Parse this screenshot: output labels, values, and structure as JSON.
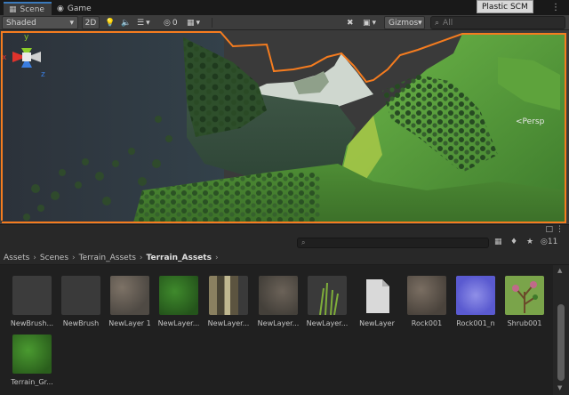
{
  "tabs": [
    {
      "label": "Scene",
      "icon": "grid-icon",
      "active": true
    },
    {
      "label": "Game",
      "icon": "gamepad-icon",
      "active": false
    }
  ],
  "plastic_label": "Plastic SCM",
  "toolbar": {
    "shading_mode": "Shaded",
    "mode_2d": "2D",
    "hidden_count": "0",
    "gizmos_label": "Gizmos",
    "search_placeholder": "All"
  },
  "viewport": {
    "projection_label": "Persp",
    "axes": {
      "x": "x",
      "y": "y",
      "z": "z"
    }
  },
  "project": {
    "visible_count": "11",
    "breadcrumb": [
      "Assets",
      "Scenes",
      "Terrain_Assets",
      "Terrain_Assets"
    ],
    "assets": [
      {
        "name": "NewBrush...",
        "thumb": "brush"
      },
      {
        "name": "NewBrush",
        "thumb": "plain"
      },
      {
        "name": "NewLayer 1",
        "thumb": "dirt"
      },
      {
        "name": "NewLayer...",
        "thumb": "grass"
      },
      {
        "name": "NewLayer...",
        "thumb": "bark"
      },
      {
        "name": "NewLayer...",
        "thumb": "dirt"
      },
      {
        "name": "NewLayer...",
        "thumb": "reeds"
      },
      {
        "name": "NewLayer",
        "thumb": "file"
      },
      {
        "name": "Rock001",
        "thumb": "rock"
      },
      {
        "name": "Rock001_n",
        "thumb": "normal"
      },
      {
        "name": "Shrub001",
        "thumb": "shrub"
      },
      {
        "name": "Terrain_Gr...",
        "thumb": "grass"
      }
    ]
  },
  "colors": {
    "selection_outline": "#f57c1f",
    "accent": "#3a79bb",
    "axis_x": "#e0332c",
    "axis_y": "#8ccd2a",
    "axis_z": "#3a7de0"
  }
}
